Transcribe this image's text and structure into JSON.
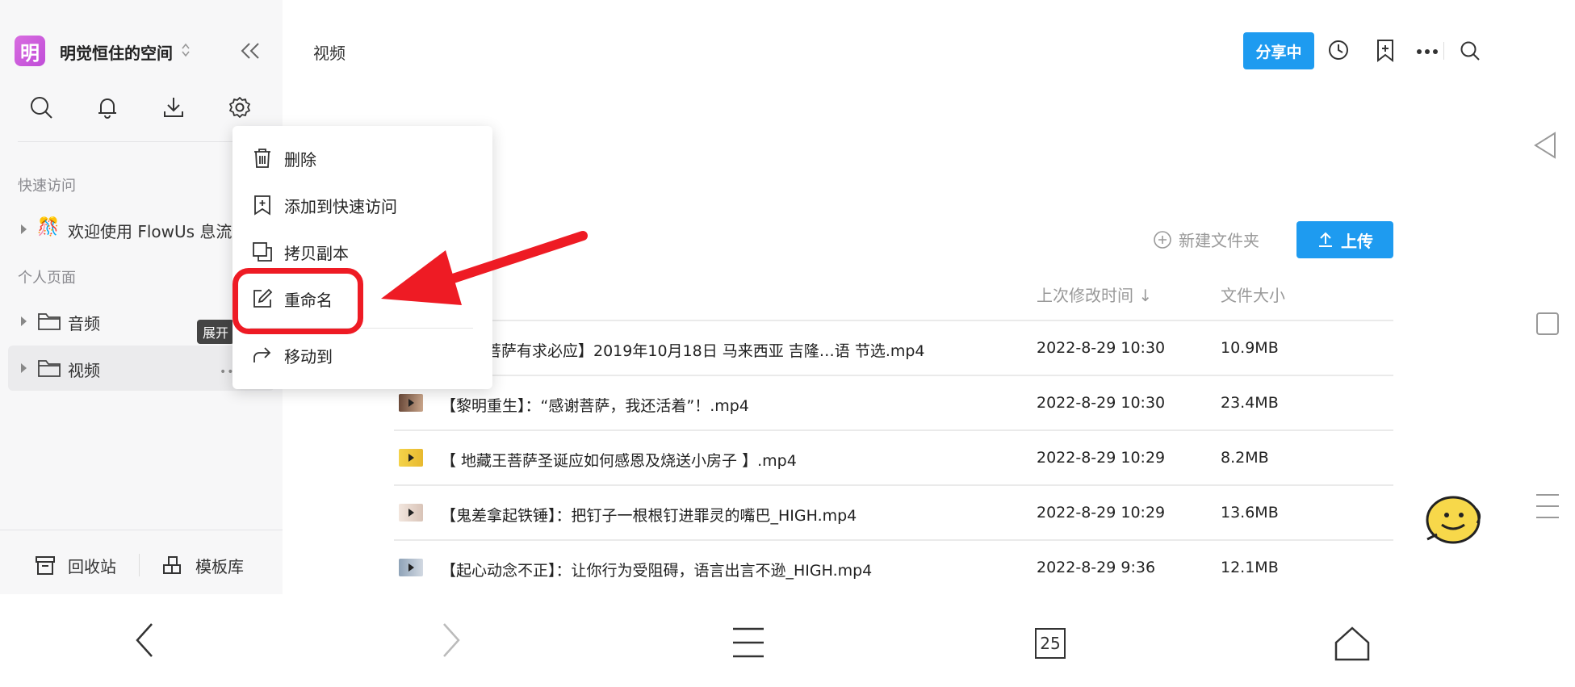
{
  "workspace": {
    "avatar_char": "明",
    "name": "明觉恒住的空间"
  },
  "sidebar": {
    "quick_access_title": "快速访问",
    "quick_access_items": [
      {
        "label": "欢迎使用 FlowUs 息流",
        "emoji": "🎊"
      }
    ],
    "personal_title": "个人页面",
    "personal_items": [
      {
        "label": "音频"
      },
      {
        "label": "视频",
        "more": "•••"
      }
    ],
    "tooltip": "展开",
    "bottom": {
      "trash_label": "回收站",
      "templates_label": "模板库"
    }
  },
  "header": {
    "breadcrumb": "视频",
    "share_label": "分享中"
  },
  "context_menu": {
    "items": [
      {
        "label": "删除",
        "icon": "trash-icon"
      },
      {
        "label": "添加到快速访问",
        "icon": "bookmark-plus-icon"
      },
      {
        "label": "拷贝副本",
        "icon": "copy-icon"
      },
      {
        "label": "重命名",
        "icon": "edit-icon"
      },
      {
        "label": "移动到",
        "icon": "forward-arrow-icon"
      }
    ]
  },
  "toolbar": {
    "new_folder_label": "新建文件夹",
    "upload_label": "上传"
  },
  "table": {
    "columns": {
      "modified": "上次修改时间 ↓",
      "size": "文件大小"
    },
    "rows": [
      {
        "name": "…音菩萨有求必应】2019年10月18日 马来西亚 吉隆…语 节选.mp4",
        "modified": "2022-8-29 10:30",
        "size": "10.9MB"
      },
      {
        "name": "【黎明重生】：“感谢菩萨，我还活着”！.mp4",
        "modified": "2022-8-29 10:30",
        "size": "23.4MB"
      },
      {
        "name": "【 地藏王菩萨圣诞应如何感恩及烧送小房子 】.mp4",
        "modified": "2022-8-29 10:29",
        "size": "8.2MB"
      },
      {
        "name": "【鬼差拿起铁锤】：把钉子一根根钉进罪灵的嘴巴_HIGH.mp4",
        "modified": "2022-8-29 10:29",
        "size": "13.6MB"
      },
      {
        "name": "【起心动念不正】：让你行为受阻碍，语言出言不逊_HIGH.mp4",
        "modified": "2022-8-29 9:36",
        "size": "12.1MB"
      }
    ]
  },
  "navbar": {
    "calendar_day": "25"
  },
  "colors": {
    "accent": "#1e9bf0",
    "annotation_red": "#ee1b24",
    "avatar": "#d86de0"
  }
}
